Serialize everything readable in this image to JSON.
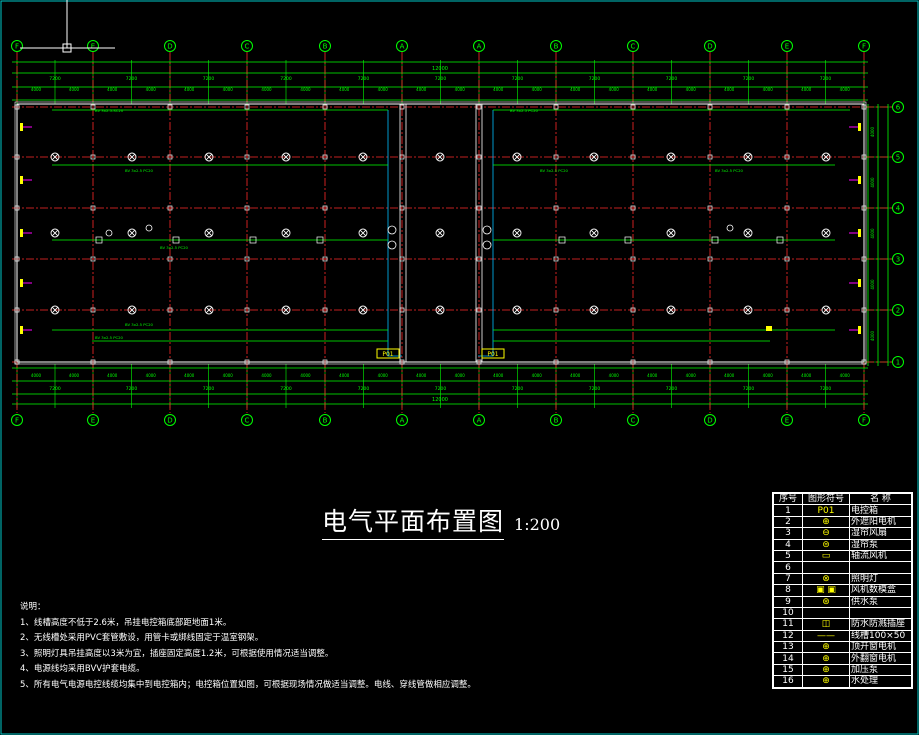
{
  "drawing": {
    "title": "电气平面布置图",
    "scale": "1:200",
    "colors": {
      "background": "#000000",
      "grid": "#ff2a2a",
      "dims": "#00ff00",
      "walls": "#ffffff",
      "axis_bubble": "#00ff00",
      "lights": "#ffffff",
      "cable": "#00ff00",
      "feeder": "#00bfff",
      "box": "#ffff00",
      "device": "#ff00ff"
    }
  },
  "axes": {
    "top": [
      "F",
      "E",
      "D",
      "C",
      "B",
      "A",
      "A",
      "B",
      "C",
      "D",
      "E",
      "F"
    ],
    "bottom": [
      "F",
      "E",
      "D",
      "C",
      "B",
      "A",
      "A",
      "B",
      "C",
      "D",
      "E",
      "F"
    ],
    "right": [
      "6",
      "5",
      "4",
      "3",
      "2",
      "1"
    ]
  },
  "dimensions": {
    "overall": "12000",
    "bay": "7200",
    "sub_spans": [
      "4000",
      "4000",
      "4000",
      "4000",
      "4000",
      "4000",
      "4000",
      "4000",
      "4000",
      "4000",
      "4000",
      "4000",
      "4000",
      "4000",
      "4000",
      "4000",
      "4000",
      "4000",
      "4000",
      "4000",
      "4000",
      "4000",
      "4000",
      "4000"
    ],
    "right_spans": [
      "4000",
      "4000",
      "4000",
      "4000",
      "4000"
    ]
  },
  "panels": {
    "left_box": "P01",
    "right_box": "P01"
  },
  "cable_labels": [
    "BV 3x2.5-SC20",
    "BV 3x2.5 PC20",
    "BV 3x2.5 PC20",
    "BV 3x2.5 PC20",
    "BV 3x2.5 PC20",
    "BV 3x2.5 PC20",
    "BV 3x2.5 PC20",
    "BV 3x2.5 PC20"
  ],
  "notes": {
    "heading": "说明：",
    "items": [
      "1、线槽高度不低于2.6米，吊挂电控箱底部距地面1米。",
      "2、无线槽处采用PVC套管敷设，用管卡或绑线固定于温室钢架。",
      "3、照明灯具吊挂高度以3米为宜，插座固定高度1.2米，可根据使用情况适当调整。",
      "4、电源线均采用BVV护套电缆。",
      "5、所有电气电源电控线缆均集中到电控箱内；电控箱位置如图，可根据现场情况做适当调整。电线、穿线管做相应调整。"
    ]
  },
  "legend": {
    "headers": [
      "序号",
      "图形符号",
      "名  称"
    ],
    "rows": [
      {
        "no": "1",
        "symbol": "P01",
        "name": "电控箱"
      },
      {
        "no": "2",
        "symbol": "⊕",
        "name": "外遮阳电机"
      },
      {
        "no": "3",
        "symbol": "⊖",
        "name": "湿帘风扇"
      },
      {
        "no": "4",
        "symbol": "⊜",
        "name": "湿帘泵"
      },
      {
        "no": "5",
        "symbol": "▭",
        "name": "轴流风机"
      },
      {
        "no": "6",
        "symbol": "",
        "name": ""
      },
      {
        "no": "7",
        "symbol": "⊗",
        "name": "照明灯"
      },
      {
        "no": "8",
        "symbol": "▣ ▣",
        "name": "风机数模盒"
      },
      {
        "no": "9",
        "symbol": "⊛",
        "name": "供水泵"
      },
      {
        "no": "10",
        "symbol": "",
        "name": ""
      },
      {
        "no": "11",
        "symbol": "◫",
        "name": "防水防溅插座"
      },
      {
        "no": "12",
        "symbol": "——",
        "name": "线槽100×50"
      },
      {
        "no": "13",
        "symbol": "⊕",
        "name": "顶开窗电机"
      },
      {
        "no": "14",
        "symbol": "⊕",
        "name": "外翻窗电机"
      },
      {
        "no": "15",
        "symbol": "⊕",
        "name": "加压泵"
      },
      {
        "no": "16",
        "symbol": "⊕",
        "name": "水处理"
      }
    ]
  }
}
